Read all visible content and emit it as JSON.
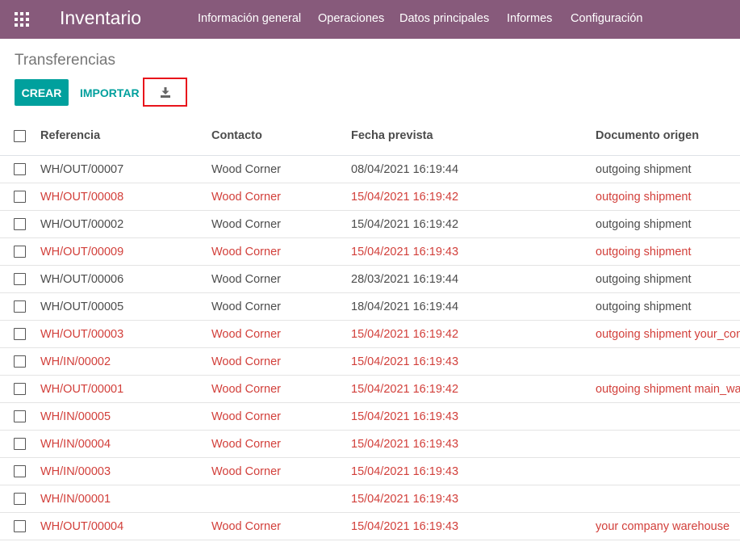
{
  "app": {
    "title": "Inventario",
    "menu": [
      "Información general",
      "Operaciones",
      "Datos principales",
      "Informes",
      "Configuración"
    ]
  },
  "breadcrumb": "Transferencias",
  "toolbar": {
    "create_label": "CREAR",
    "import_label": "IMPORTAR",
    "export_icon": "download-icon"
  },
  "colors": {
    "navbar": "#875a7b",
    "primary": "#00a09d",
    "late": "#d23f3a",
    "highlight_box": "#e8141b"
  },
  "table": {
    "columns": [
      "Referencia",
      "Contacto",
      "Fecha prevista",
      "Documento origen"
    ],
    "rows": [
      {
        "ref": "WH/OUT/00007",
        "contact": "Wood Corner",
        "date": "08/04/2021 16:19:44",
        "origin": "outgoing shipment",
        "late": false
      },
      {
        "ref": "WH/OUT/00008",
        "contact": "Wood Corner",
        "date": "15/04/2021 16:19:42",
        "origin": "outgoing shipment",
        "late": true
      },
      {
        "ref": "WH/OUT/00002",
        "contact": "Wood Corner",
        "date": "15/04/2021 16:19:42",
        "origin": "outgoing shipment",
        "late": false
      },
      {
        "ref": "WH/OUT/00009",
        "contact": "Wood Corner",
        "date": "15/04/2021 16:19:43",
        "origin": "outgoing shipment",
        "late": true
      },
      {
        "ref": "WH/OUT/00006",
        "contact": "Wood Corner",
        "date": "28/03/2021 16:19:44",
        "origin": "outgoing shipment",
        "late": false
      },
      {
        "ref": "WH/OUT/00005",
        "contact": "Wood Corner",
        "date": "18/04/2021 16:19:44",
        "origin": "outgoing shipment",
        "late": false
      },
      {
        "ref": "WH/OUT/00003",
        "contact": "Wood Corner",
        "date": "15/04/2021 16:19:42",
        "origin": "outgoing shipment your_con",
        "late": true
      },
      {
        "ref": "WH/IN/00002",
        "contact": "Wood Corner",
        "date": "15/04/2021 16:19:43",
        "origin": "",
        "late": true
      },
      {
        "ref": "WH/OUT/00001",
        "contact": "Wood Corner",
        "date": "15/04/2021 16:19:42",
        "origin": "outgoing shipment main_wa",
        "late": true
      },
      {
        "ref": "WH/IN/00005",
        "contact": "Wood Corner",
        "date": "15/04/2021 16:19:43",
        "origin": "",
        "late": true
      },
      {
        "ref": "WH/IN/00004",
        "contact": "Wood Corner",
        "date": "15/04/2021 16:19:43",
        "origin": "",
        "late": true
      },
      {
        "ref": "WH/IN/00003",
        "contact": "Wood Corner",
        "date": "15/04/2021 16:19:43",
        "origin": "",
        "late": true
      },
      {
        "ref": "WH/IN/00001",
        "contact": "",
        "date": "15/04/2021 16:19:43",
        "origin": "",
        "late": true
      },
      {
        "ref": "WH/OUT/00004",
        "contact": "Wood Corner",
        "date": "15/04/2021 16:19:43",
        "origin": "your company warehouse",
        "late": true
      }
    ]
  }
}
